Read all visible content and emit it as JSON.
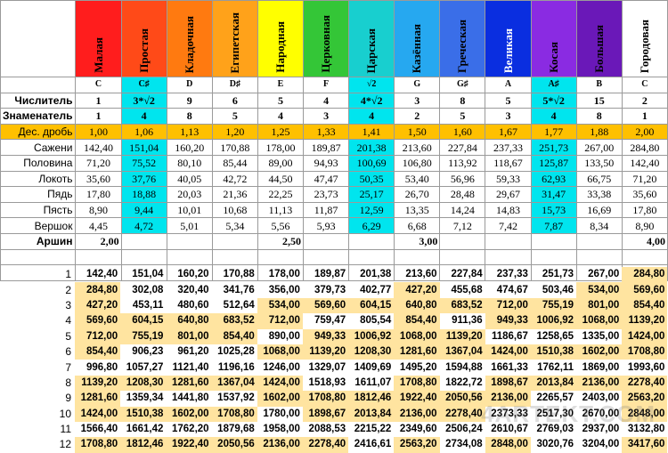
{
  "columns": [
    {
      "name": "Малая",
      "color": "#ff1d1d",
      "text": "#000000"
    },
    {
      "name": "Простая",
      "color": "#ff4a18",
      "text": "#000000"
    },
    {
      "name": "Кладочная",
      "color": "#ff7a10",
      "text": "#000000"
    },
    {
      "name": "Египетская",
      "color": "#ffa21a",
      "text": "#000000"
    },
    {
      "name": "Народная",
      "color": "#ffff00",
      "text": "#000000"
    },
    {
      "name": "Церковная",
      "color": "#34c637",
      "text": "#000000"
    },
    {
      "name": "Царская",
      "color": "#18cfcf",
      "text": "#000000"
    },
    {
      "name": "Казённая",
      "color": "#26a8f0",
      "text": "#000000"
    },
    {
      "name": "Греческая",
      "color": "#3a6ee8",
      "text": "#000000"
    },
    {
      "name": "Великая",
      "color": "#0a2ee0",
      "text": "#ffffff"
    },
    {
      "name": "Косая",
      "color": "#8a2be2",
      "text": "#000000"
    },
    {
      "name": "Большая",
      "color": "#6a18b8",
      "text": "#000000"
    },
    {
      "name": "Городовая",
      "color": "#ffffff",
      "text": "#000000"
    }
  ],
  "notes": [
    "C",
    "C♯",
    "D",
    "D♯",
    "E",
    "F",
    "√2",
    "G",
    "G♯",
    "A",
    "A♯",
    "B",
    "C"
  ],
  "rows": [
    {
      "label": "Числитель",
      "bold": true,
      "values": [
        "1",
        "3*√2",
        "9",
        "6",
        "5",
        "4",
        "4*√2",
        "3",
        "8",
        "5",
        "5*√2",
        "15",
        "2"
      ]
    },
    {
      "label": "Знаменатель",
      "bold": true,
      "values": [
        "1",
        "4",
        "8",
        "5",
        "4",
        "3",
        "4",
        "2",
        "5",
        "3",
        "4",
        "8",
        "1"
      ]
    },
    {
      "label": "Дес. дробь",
      "bold": false,
      "gold": true,
      "values": [
        "1,00",
        "1,06",
        "1,13",
        "1,20",
        "1,25",
        "1,33",
        "1,41",
        "1,50",
        "1,60",
        "1,67",
        "1,77",
        "1,88",
        "2,00"
      ]
    },
    {
      "label": "Сажени",
      "bold": false,
      "values": [
        "142,40",
        "151,04",
        "160,20",
        "170,88",
        "178,00",
        "189,87",
        "201,38",
        "213,60",
        "227,84",
        "237,33",
        "251,73",
        "267,00",
        "284,80"
      ]
    },
    {
      "label": "Половина",
      "bold": false,
      "values": [
        "71,20",
        "75,52",
        "80,10",
        "85,44",
        "89,00",
        "94,93",
        "100,69",
        "106,80",
        "113,92",
        "118,67",
        "125,87",
        "133,50",
        "142,40"
      ]
    },
    {
      "label": "Локоть",
      "bold": false,
      "values": [
        "35,60",
        "37,76",
        "40,05",
        "42,72",
        "44,50",
        "47,47",
        "50,35",
        "53,40",
        "56,96",
        "59,33",
        "62,93",
        "66,75",
        "71,20"
      ]
    },
    {
      "label": "Пядь",
      "bold": false,
      "values": [
        "17,80",
        "18,88",
        "20,03",
        "21,36",
        "22,25",
        "23,73",
        "25,17",
        "26,70",
        "28,48",
        "29,67",
        "31,47",
        "33,38",
        "35,60"
      ]
    },
    {
      "label": "Пясть",
      "bold": false,
      "values": [
        "8,90",
        "9,44",
        "10,01",
        "10,68",
        "11,13",
        "11,87",
        "12,59",
        "13,35",
        "14,24",
        "14,83",
        "15,73",
        "16,69",
        "17,80"
      ]
    },
    {
      "label": "Вершок",
      "bold": false,
      "values": [
        "4,45",
        "4,72",
        "5,01",
        "5,34",
        "5,56",
        "5,93",
        "6,29",
        "6,68",
        "7,12",
        "7,42",
        "7,87",
        "8,34",
        "8,90"
      ]
    },
    {
      "label": "Аршин",
      "bold": true,
      "values": [
        "2,00",
        "",
        "",
        "",
        "2,50",
        "",
        "",
        "3,00",
        "",
        "",
        "",
        "",
        "4,00"
      ]
    }
  ],
  "cyan_columns": [
    1,
    6,
    10
  ],
  "multiples": [
    {
      "n": "1",
      "values": [
        "142,40",
        "151,04",
        "160,20",
        "170,88",
        "178,00",
        "189,87",
        "201,38",
        "213,60",
        "227,84",
        "237,33",
        "251,73",
        "267,00",
        "284,80"
      ],
      "hl": [
        12
      ]
    },
    {
      "n": "2",
      "values": [
        "284,80",
        "302,08",
        "320,40",
        "341,76",
        "356,00",
        "379,73",
        "402,77",
        "427,20",
        "455,68",
        "474,67",
        "503,46",
        "534,00",
        "569,60"
      ],
      "hl": [
        0,
        7,
        11,
        12
      ]
    },
    {
      "n": "3",
      "values": [
        "427,20",
        "453,11",
        "480,60",
        "512,64",
        "534,00",
        "569,60",
        "604,15",
        "640,80",
        "683,52",
        "712,00",
        "755,19",
        "801,00",
        "854,40"
      ],
      "hl": [
        0,
        4,
        5,
        6,
        7,
        8,
        9,
        10,
        11,
        12
      ]
    },
    {
      "n": "4",
      "values": [
        "569,60",
        "604,15",
        "640,80",
        "683,52",
        "712,00",
        "759,47",
        "805,54",
        "854,40",
        "911,36",
        "949,33",
        "1006,92",
        "1068,00",
        "1139,20"
      ],
      "hl": [
        0,
        1,
        2,
        3,
        4,
        7,
        9,
        10,
        11,
        12
      ]
    },
    {
      "n": "5",
      "values": [
        "712,00",
        "755,19",
        "801,00",
        "854,40",
        "890,00",
        "949,33",
        "1006,92",
        "1068,00",
        "1139,20",
        "1186,67",
        "1258,65",
        "1335,00",
        "1424,00"
      ],
      "hl": [
        0,
        1,
        2,
        3,
        5,
        6,
        7,
        8,
        12
      ]
    },
    {
      "n": "6",
      "values": [
        "854,40",
        "906,23",
        "961,20",
        "1025,28",
        "1068,00",
        "1139,20",
        "1208,30",
        "1281,60",
        "1367,04",
        "1424,00",
        "1510,38",
        "1602,00",
        "1708,80"
      ],
      "hl": [
        0,
        4,
        5,
        6,
        7,
        8,
        9,
        10,
        11,
        12
      ]
    },
    {
      "n": "7",
      "values": [
        "996,80",
        "1057,27",
        "1121,40",
        "1196,16",
        "1246,00",
        "1329,07",
        "1409,69",
        "1495,20",
        "1594,88",
        "1661,33",
        "1762,11",
        "1869,00",
        "1993,60"
      ],
      "hl": []
    },
    {
      "n": "8",
      "values": [
        "1139,20",
        "1208,30",
        "1281,60",
        "1367,04",
        "1424,00",
        "1518,93",
        "1611,07",
        "1708,80",
        "1822,72",
        "1898,67",
        "2013,84",
        "2136,00",
        "2278,40"
      ],
      "hl": [
        0,
        1,
        2,
        3,
        4,
        7,
        9,
        10,
        11,
        12
      ]
    },
    {
      "n": "9",
      "values": [
        "1281,60",
        "1359,34",
        "1441,80",
        "1537,92",
        "1602,00",
        "1708,80",
        "1812,46",
        "1922,40",
        "2050,56",
        "2136,00",
        "2265,57",
        "2403,00",
        "2563,20"
      ],
      "hl": [
        0,
        4,
        5,
        6,
        7,
        8,
        9,
        12
      ]
    },
    {
      "n": "10",
      "values": [
        "1424,00",
        "1510,38",
        "1602,00",
        "1708,80",
        "1780,00",
        "1898,67",
        "2013,84",
        "2136,00",
        "2278,40",
        "2373,33",
        "2517,30",
        "2670,00",
        "2848,00"
      ],
      "hl": [
        0,
        1,
        2,
        3,
        5,
        6,
        7,
        8,
        12
      ]
    },
    {
      "n": "11",
      "values": [
        "1566,40",
        "1661,42",
        "1762,20",
        "1879,68",
        "1958,00",
        "2088,53",
        "2215,22",
        "2349,60",
        "2506,24",
        "2610,67",
        "2769,03",
        "2937,00",
        "3132,80"
      ],
      "hl": []
    },
    {
      "n": "12",
      "values": [
        "1708,80",
        "1812,46",
        "1922,40",
        "2050,56",
        "2136,00",
        "2278,40",
        "2416,61",
        "2563,20",
        "2734,08",
        "2848,00",
        "3020,76",
        "3204,00",
        "3417,60"
      ],
      "hl": [
        0,
        1,
        2,
        3,
        4,
        5,
        7,
        9,
        12
      ]
    }
  ],
  "watermark": "4ARTEKT.COM"
}
